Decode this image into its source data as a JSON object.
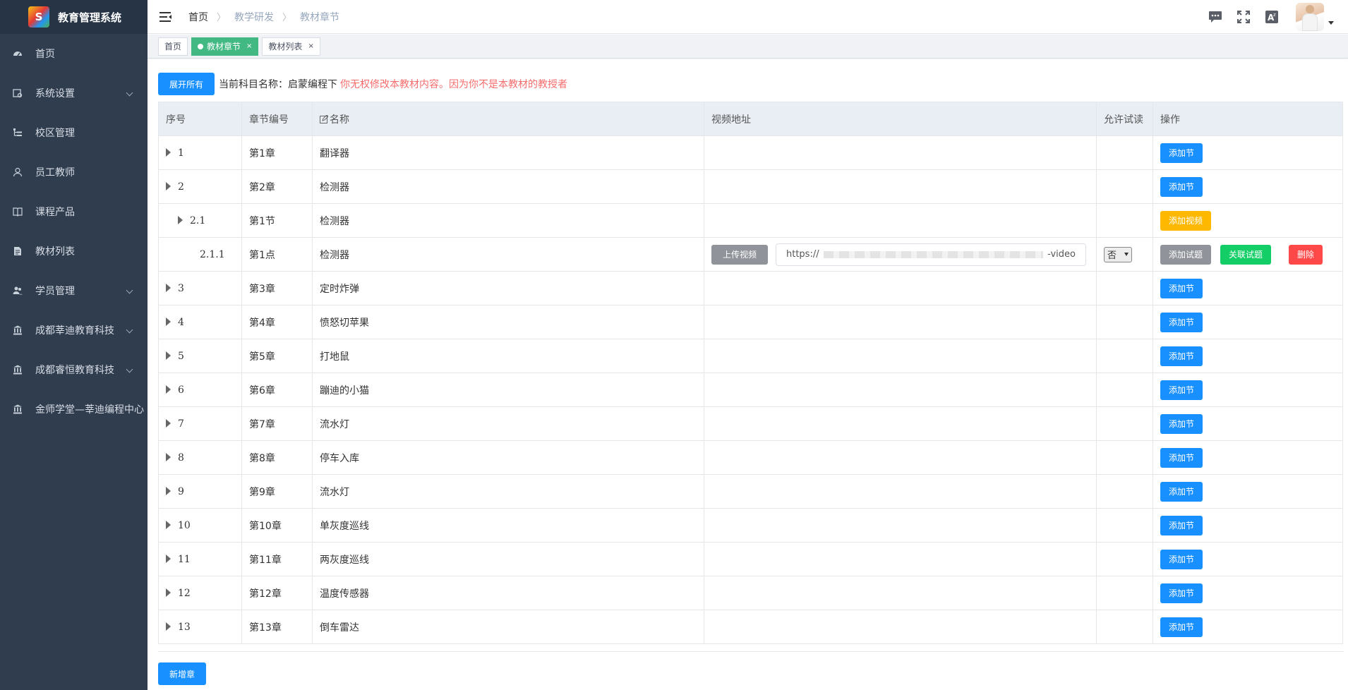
{
  "app": {
    "title": "教育管理系统",
    "logo_letter": "S"
  },
  "sidebar": {
    "items": [
      {
        "label": "首页",
        "icon": "dashboard-icon",
        "has_arrow": false
      },
      {
        "label": "系统设置",
        "icon": "settings-icon",
        "has_arrow": true
      },
      {
        "label": "校区管理",
        "icon": "tree-icon",
        "has_arrow": false
      },
      {
        "label": "员工教师",
        "icon": "user-icon",
        "has_arrow": false
      },
      {
        "label": "课程产品",
        "icon": "book-icon",
        "has_arrow": false
      },
      {
        "label": "教材列表",
        "icon": "document-icon",
        "has_arrow": false
      },
      {
        "label": "学员管理",
        "icon": "people-icon",
        "has_arrow": true
      },
      {
        "label": "成都莘迪教育科技",
        "icon": "bank-icon",
        "has_arrow": true
      },
      {
        "label": "成都睿恒教育科技",
        "icon": "bank-icon",
        "has_arrow": true
      },
      {
        "label": "金师学堂—莘迪编程中心",
        "icon": "bank-icon",
        "has_arrow": false
      }
    ]
  },
  "header": {
    "breadcrumb": [
      "首页",
      "教学研发",
      "教材章节"
    ],
    "icons": [
      "message-icon",
      "fullscreen-icon",
      "font-size-icon"
    ]
  },
  "tags": [
    {
      "label": "首页",
      "active": false,
      "closable": false
    },
    {
      "label": "教材章节",
      "active": true,
      "closable": true
    },
    {
      "label": "教材列表",
      "active": false,
      "closable": true
    }
  ],
  "toolbar": {
    "expand_label": "展开所有",
    "subject_prefix": "当前科目名称：",
    "subject_name": "启蒙编程下",
    "warning": "你无权修改本教材内容。因为你不是本教材的教授者"
  },
  "table": {
    "columns": [
      "序号",
      "章节编号",
      "名称",
      "视频地址",
      "允许试读",
      "操作"
    ],
    "rows": [
      {
        "seq": "1",
        "code": "第1章",
        "name": "翻译器",
        "level": 0,
        "type": "chapter"
      },
      {
        "seq": "2",
        "code": "第2章",
        "name": "检测器",
        "level": 0,
        "type": "chapter"
      },
      {
        "seq": "2.1",
        "code": "第1节",
        "name": "检测器",
        "level": 1,
        "type": "section"
      },
      {
        "seq": "2.1.1",
        "code": "第1点",
        "name": "检测器",
        "level": 2,
        "type": "point",
        "url_prefix": "https://",
        "url_suffix": "-video",
        "trial": "否"
      },
      {
        "seq": "3",
        "code": "第3章",
        "name": "定时炸弹",
        "level": 0,
        "type": "chapter"
      },
      {
        "seq": "4",
        "code": "第4章",
        "name": "愤怒切苹果",
        "level": 0,
        "type": "chapter"
      },
      {
        "seq": "5",
        "code": "第5章",
        "name": "打地鼠",
        "level": 0,
        "type": "chapter"
      },
      {
        "seq": "6",
        "code": "第6章",
        "name": "蹦迪的小猫",
        "level": 0,
        "type": "chapter"
      },
      {
        "seq": "7",
        "code": "第7章",
        "name": "流水灯",
        "level": 0,
        "type": "chapter"
      },
      {
        "seq": "8",
        "code": "第8章",
        "name": "停车入库",
        "level": 0,
        "type": "chapter"
      },
      {
        "seq": "9",
        "code": "第9章",
        "name": "流水灯",
        "level": 0,
        "type": "chapter"
      },
      {
        "seq": "10",
        "code": "第10章",
        "name": "单灰度巡线",
        "level": 0,
        "type": "chapter"
      },
      {
        "seq": "11",
        "code": "第11章",
        "name": "两灰度巡线",
        "level": 0,
        "type": "chapter"
      },
      {
        "seq": "12",
        "code": "第12章",
        "name": "温度传感器",
        "level": 0,
        "type": "chapter"
      },
      {
        "seq": "13",
        "code": "第13章",
        "name": "倒车雷达",
        "level": 0,
        "type": "chapter"
      }
    ],
    "buttons": {
      "add_section": "添加节",
      "add_video": "添加视频",
      "upload_video": "上传视频",
      "add_question": "添加试题",
      "link_question": "关联试题",
      "delete": "删除"
    }
  },
  "footer": {
    "add_chapter_label": "新增章"
  },
  "colors": {
    "sidebar_bg": "#2f3d4f",
    "primary": "#1890ff",
    "warning": "#ffb800",
    "success": "#13ce66",
    "danger": "#ff4949",
    "active_tag": "#42b983",
    "warning_text": "#f56c6c"
  }
}
